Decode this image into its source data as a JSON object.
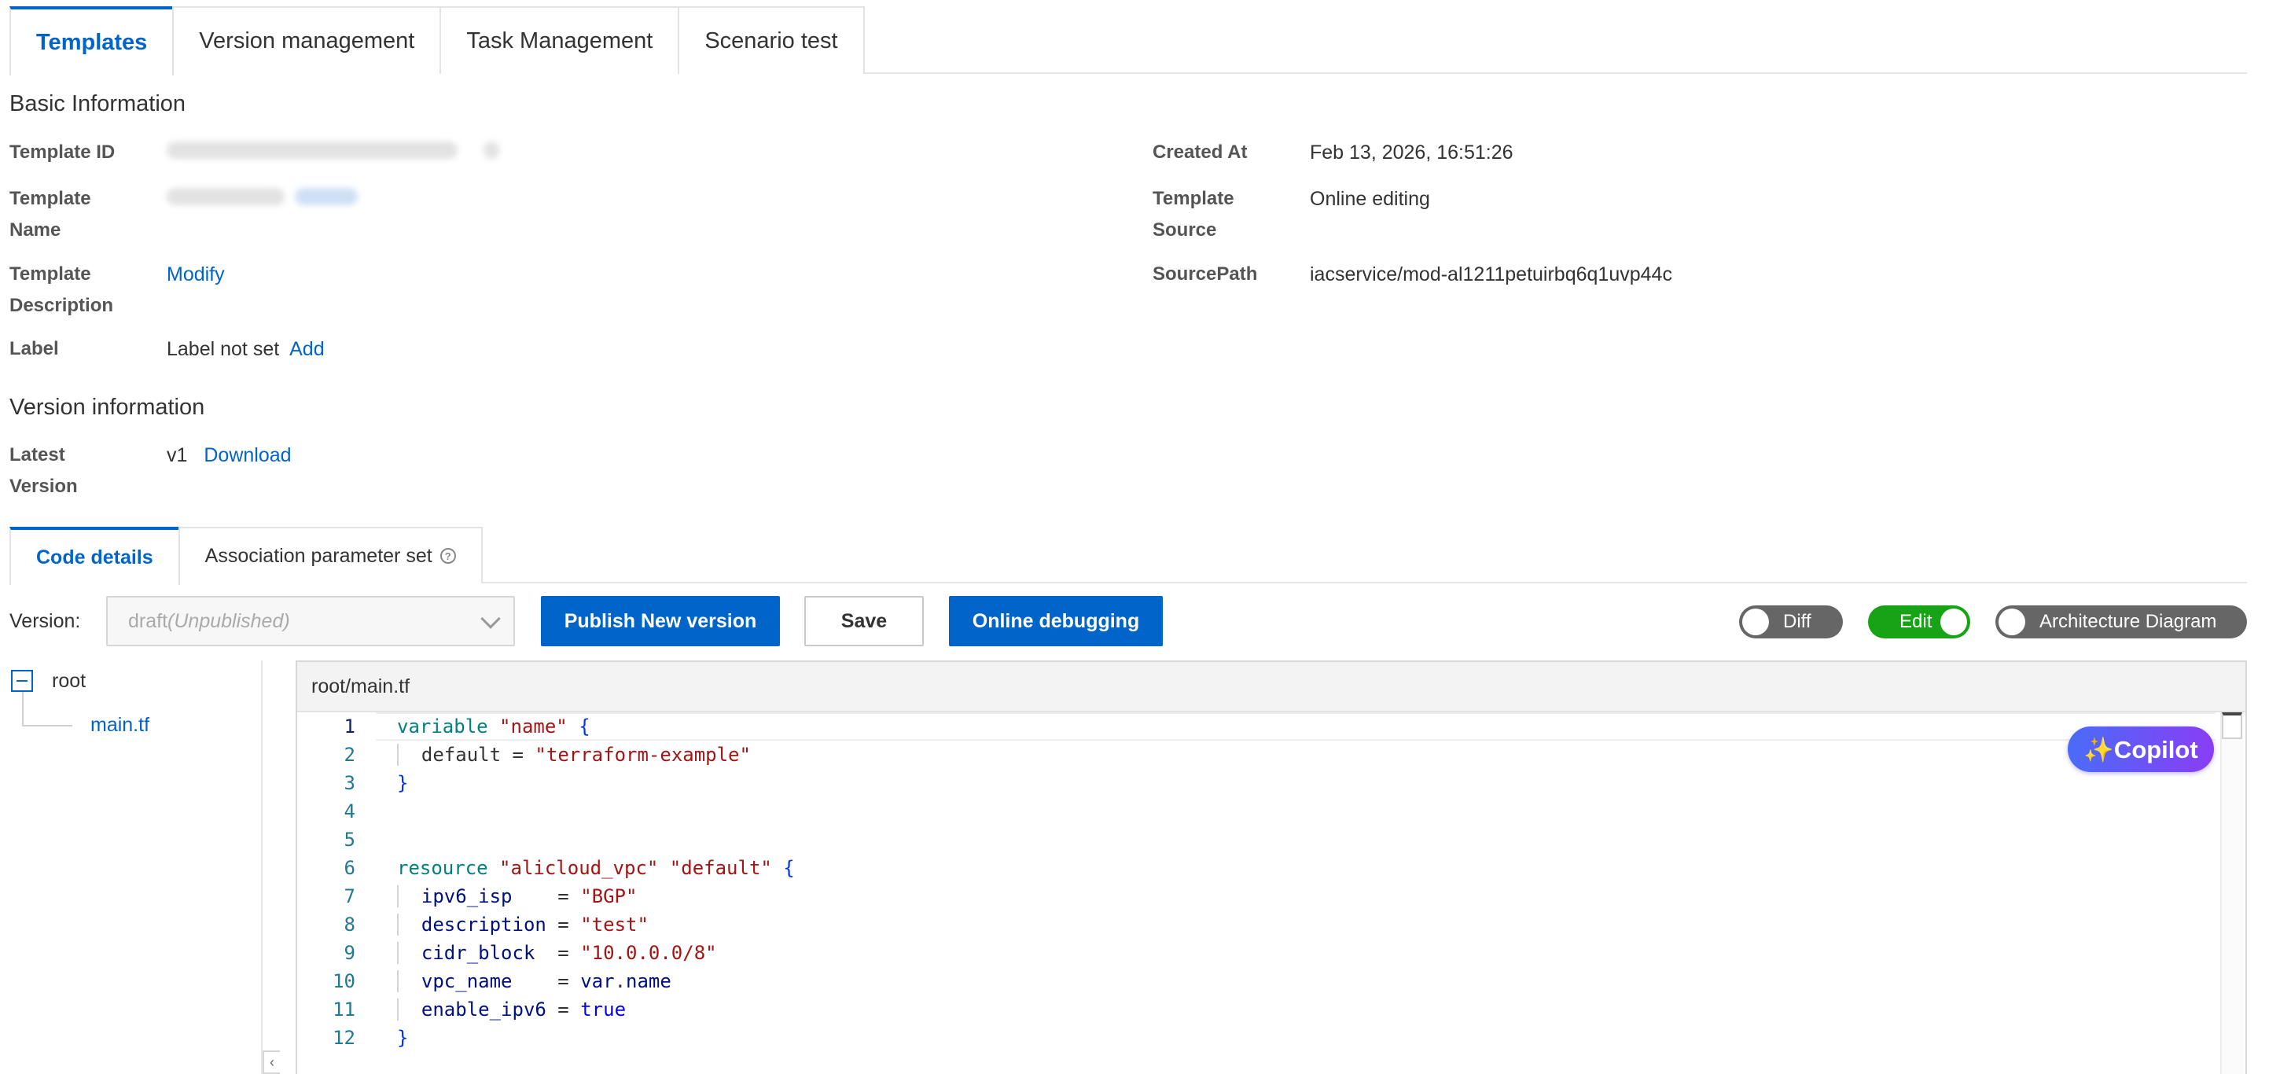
{
  "top_tabs": [
    {
      "label": "Templates",
      "active": true
    },
    {
      "label": "Version management",
      "active": false
    },
    {
      "label": "Task Management",
      "active": false
    },
    {
      "label": "Scenario test",
      "active": false
    }
  ],
  "basic_info": {
    "title": "Basic Information",
    "template_id_label": "Template ID",
    "template_name_label_1": "Template",
    "template_name_label_2": "Name",
    "template_description_label_1": "Template",
    "template_description_label_2": "Description",
    "modify_link": "Modify",
    "label_label": "Label",
    "label_value": "Label not set",
    "add_link": "Add",
    "created_at_label": "Created At",
    "created_at_value": "Feb 13, 2026, 16:51:26",
    "template_source_label_1": "Template",
    "template_source_label_2": "Source",
    "template_source_value": "Online editing",
    "source_path_label": "SourcePath",
    "source_path_value": "iacservice/mod-al1211petuirbq6q1uvp44c"
  },
  "version_info": {
    "title": "Version information",
    "latest_label_1": "Latest",
    "latest_label_2": "Version",
    "latest_value": "v1",
    "download_link": "Download"
  },
  "code_tabs": [
    {
      "label": "Code details",
      "active": true
    },
    {
      "label": "Association parameter set",
      "active": false
    }
  ],
  "toolbar": {
    "version_label": "Version:",
    "version_select": "draft",
    "version_select_status": "(Unpublished)",
    "publish_button": "Publish New version",
    "save_button": "Save",
    "debug_button": "Online debugging",
    "diff_toggle": "Diff",
    "edit_toggle": "Edit",
    "arch_toggle": "Architecture Diagram"
  },
  "toggles": {
    "diff": false,
    "edit": true,
    "architecture_diagram": false
  },
  "file_tree": {
    "root": "root",
    "files": [
      "main.tf"
    ]
  },
  "editor": {
    "path": "root/main.tf",
    "line_numbers": [
      "1",
      "2",
      "3",
      "4",
      "5",
      "6",
      "7",
      "8",
      "9",
      "10",
      "11",
      "12"
    ],
    "copilot": "✨Copilot"
  },
  "code": {
    "l1_kw": "variable",
    "l1_str": "\"name\"",
    "l2_key": "default",
    "l2_str": "\"terraform-example\"",
    "l6_kw": "resource",
    "l6_str1": "\"alicloud_vpc\"",
    "l6_str2": "\"default\"",
    "l7_key": "ipv6_isp",
    "l7_str": "\"BGP\"",
    "l8_key": "description",
    "l8_str": "\"test\"",
    "l9_key": "cidr_block",
    "l9_str": "\"10.0.0.0/8\"",
    "l10_key": "vpc_name",
    "l10_var": "var",
    "l10_name": "name",
    "l11_key": "enable_ipv6",
    "l11_bool": "true"
  },
  "colors": {
    "accent": "#0064c8",
    "toggle_on": "#16a316",
    "toggle_off": "#666666"
  }
}
